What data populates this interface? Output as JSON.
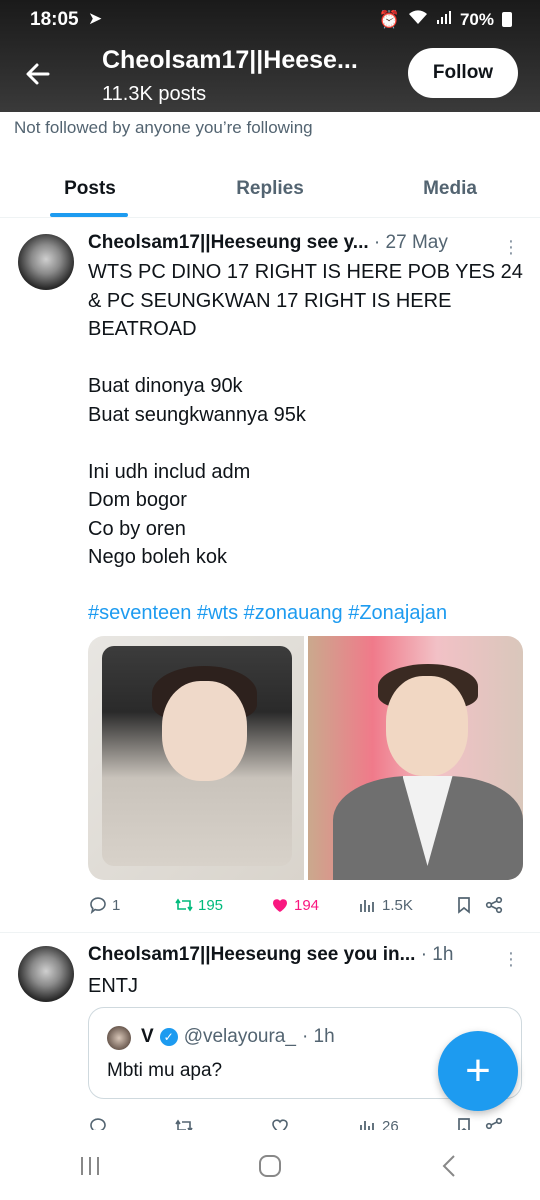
{
  "status_bar": {
    "time": "18:05",
    "battery": "70%"
  },
  "header": {
    "title": "Cheolsam17||Heese...",
    "posts_count": "11.3K posts",
    "follow_label": "Follow"
  },
  "not_followed_text": "Not followed by anyone you’re following",
  "tabs": [
    {
      "label": "Posts",
      "active": true
    },
    {
      "label": "Replies",
      "active": false
    },
    {
      "label": "Media",
      "active": false
    }
  ],
  "posts": [
    {
      "name": "Cheolsam17||Heeseung see y...",
      "date": "· 27 May",
      "text": "WTS PC DINO 17 RIGHT IS HERE POB YES 24 & PC SEUNGKWAN 17 RIGHT IS HERE BEATROAD\n\nBuat dinonya 90k\nBuat seungkwannya 95k\n\nIni udh includ adm\nDom bogor\nCo by oren\nNego boleh kok",
      "hashtags": "#seventeen #wts #zonauang #Zonajajan",
      "replies": "1",
      "reposts": "195",
      "likes": "194",
      "views": "1.5K"
    },
    {
      "name": "Cheolsam17||Heeseung see you in...",
      "date": "· 1h",
      "text": "ENTJ",
      "quote": {
        "name": "V",
        "handle": "@velayoura_",
        "time": "· 1h",
        "text": "Mbti mu apa?"
      },
      "views": "26"
    }
  ],
  "colors": {
    "accent": "#1d9bf0",
    "repost": "#00ba7c",
    "like": "#f91880"
  }
}
